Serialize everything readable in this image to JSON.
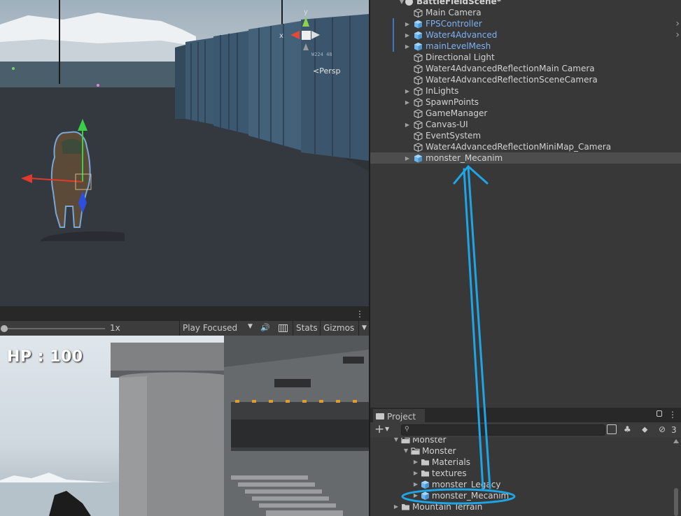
{
  "scene_view": {
    "persp_label": "<Persp",
    "axis_x": "x",
    "axis_y": "y"
  },
  "game_toolbar": {
    "scale_label": "1x",
    "play_mode": "Play Focused",
    "stats_label": "Stats",
    "gizmos_label": "Gizmos"
  },
  "game_view": {
    "hp_text": "HP : 100"
  },
  "hierarchy": {
    "scene_name": "BattleFieldScene*",
    "items": [
      {
        "label": "Main Camera",
        "prefab": false,
        "expandable": false
      },
      {
        "label": "FPSController",
        "prefab": true,
        "expandable": true
      },
      {
        "label": "Water4Advanced",
        "prefab": true,
        "expandable": true
      },
      {
        "label": "mainLevelMesh",
        "prefab": true,
        "expandable": true
      },
      {
        "label": "Directional Light",
        "prefab": false,
        "expandable": false
      },
      {
        "label": "Water4AdvancedReflectionMain Camera",
        "prefab": false,
        "expandable": false
      },
      {
        "label": "Water4AdvancedReflectionSceneCamera",
        "prefab": false,
        "expandable": false
      },
      {
        "label": "InLights",
        "prefab": false,
        "expandable": true
      },
      {
        "label": "SpawnPoints",
        "prefab": false,
        "expandable": true
      },
      {
        "label": "GameManager",
        "prefab": false,
        "expandable": false
      },
      {
        "label": "Canvas-UI",
        "prefab": false,
        "expandable": true
      },
      {
        "label": "EventSystem",
        "prefab": false,
        "expandable": false
      },
      {
        "label": "Water4AdvancedReflectionMiniMap_Camera",
        "prefab": false,
        "expandable": false
      },
      {
        "label": "monster_Mecanim",
        "prefab": false,
        "expandable": true
      }
    ]
  },
  "project": {
    "tab_label": "Project",
    "hidden_count": "3",
    "tree": [
      {
        "label": "Monster",
        "type": "folder-open",
        "depth": 0
      },
      {
        "label": "Monster",
        "type": "folder-open",
        "depth": 1
      },
      {
        "label": "Materials",
        "type": "folder",
        "depth": 2
      },
      {
        "label": "textures",
        "type": "folder",
        "depth": 2
      },
      {
        "label": "monster_Legacy",
        "type": "prefab",
        "depth": 2
      },
      {
        "label": "monster_Mecanim",
        "type": "prefab",
        "depth": 2
      },
      {
        "label": "Mountain Terrain",
        "type": "folder",
        "depth": 0
      }
    ]
  },
  "colors": {
    "prefab_text": "#7cb1f2",
    "annotation": "#1ea5e6",
    "selected_row": "#4d4d4d"
  }
}
